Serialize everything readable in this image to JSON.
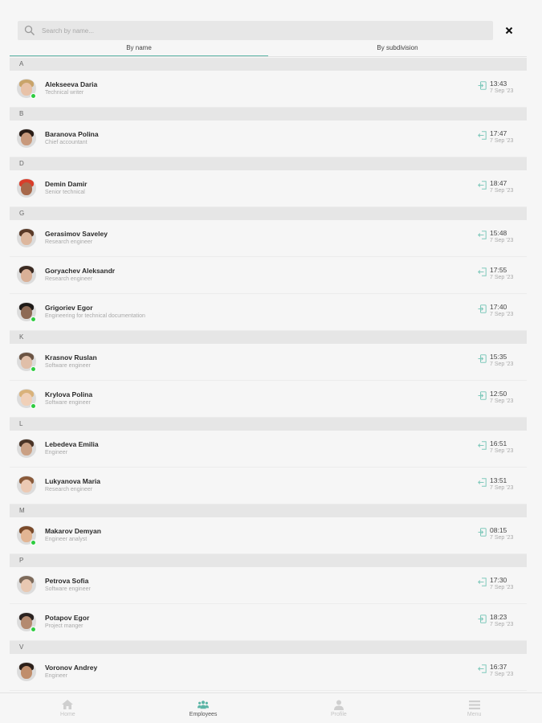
{
  "search": {
    "placeholder": "Search by name..."
  },
  "tabs": [
    {
      "label": "By name",
      "active": true
    },
    {
      "label": "By subdivision",
      "active": false
    }
  ],
  "sections": [
    {
      "letter": "A",
      "employees": [
        {
          "name": "Alekseeva Daria",
          "position": "Technical writer",
          "time": "13:43",
          "date": "7 Sep '23",
          "status": "in",
          "online": true,
          "skin": "#e8c2a8",
          "hair": "#c9a46a"
        }
      ]
    },
    {
      "letter": "B",
      "employees": [
        {
          "name": "Baranova Polina",
          "position": "Chief accountant",
          "time": "17:47",
          "date": "7 Sep '23",
          "status": "out",
          "online": false,
          "skin": "#c8997c",
          "hair": "#2a1d17"
        }
      ]
    },
    {
      "letter": "D",
      "employees": [
        {
          "name": "Demin Damir",
          "position": "Senior technical",
          "time": "18:47",
          "date": "7 Sep '23",
          "status": "out",
          "online": false,
          "skin": "#a7684a",
          "hair": "#d93d2a"
        }
      ]
    },
    {
      "letter": "G",
      "employees": [
        {
          "name": "Gerasimov Saveley",
          "position": "Research engineer",
          "time": "15:48",
          "date": "7 Sep '23",
          "status": "out",
          "online": false,
          "skin": "#ddb79e",
          "hair": "#5a3a28"
        },
        {
          "name": "Goryachev Aleksandr",
          "position": "Research engineer",
          "time": "17:55",
          "date": "7 Sep '23",
          "status": "out",
          "online": false,
          "skin": "#d9b097",
          "hair": "#3b2a22"
        },
        {
          "name": "Grigoriev Egor",
          "position": "Engineering for technical documentation",
          "time": "17:40",
          "date": "7 Sep '23",
          "status": "in",
          "online": true,
          "skin": "#8d6a55",
          "hair": "#1e1a18"
        }
      ]
    },
    {
      "letter": "K",
      "employees": [
        {
          "name": "Krasnov Ruslan",
          "position": "Software engineer",
          "time": "15:35",
          "date": "7 Sep '23",
          "status": "in",
          "online": true,
          "skin": "#e0bfa9",
          "hair": "#6b5444"
        },
        {
          "name": "Krylova Polina",
          "position": "Software engineer",
          "time": "12:50",
          "date": "7 Sep '23",
          "status": "in",
          "online": true,
          "skin": "#f0d0b8",
          "hair": "#d9b27a"
        }
      ]
    },
    {
      "letter": "L",
      "employees": [
        {
          "name": "Lebedeva Emilia",
          "position": "Engineer",
          "time": "16:51",
          "date": "7 Sep '23",
          "status": "out",
          "online": false,
          "skin": "#caa084",
          "hair": "#4a3426"
        },
        {
          "name": "Lukyanova Maria",
          "position": "Research engineer",
          "time": "13:51",
          "date": "7 Sep '23",
          "status": "out",
          "online": false,
          "skin": "#ecc9b3",
          "hair": "#8a5a3a"
        }
      ]
    },
    {
      "letter": "M",
      "employees": [
        {
          "name": "Makarov Demyan",
          "position": "Engineer analyst",
          "time": "08:15",
          "date": "7 Sep '23",
          "status": "in",
          "online": true,
          "skin": "#e2b593",
          "hair": "#7a4a2a"
        }
      ]
    },
    {
      "letter": "P",
      "employees": [
        {
          "name": "Petrova Sofia",
          "position": "Software engineer",
          "time": "17:30",
          "date": "7 Sep '23",
          "status": "out",
          "online": false,
          "skin": "#e8c8b2",
          "hair": "#7d6a5a"
        },
        {
          "name": "Potapov Egor",
          "position": "Project manger",
          "time": "18:23",
          "date": "7 Sep '23",
          "status": "in",
          "online": true,
          "skin": "#b48a70",
          "hair": "#2a2220"
        }
      ]
    },
    {
      "letter": "V",
      "employees": [
        {
          "name": "Voronov Andrey",
          "position": "Engineer",
          "time": "16:37",
          "date": "7 Sep '23",
          "status": "out",
          "online": false,
          "skin": "#c08e6c",
          "hair": "#2c201a"
        }
      ]
    }
  ],
  "bottom_nav": [
    {
      "label": "Home",
      "icon": "home-icon",
      "active": false
    },
    {
      "label": "Employees",
      "icon": "employees-icon",
      "active": true
    },
    {
      "label": "Profile",
      "icon": "profile-icon",
      "active": false
    },
    {
      "label": "Menu",
      "icon": "menu-icon",
      "active": false
    }
  ],
  "colors": {
    "accent": "#5bb5a6",
    "online": "#2ecc40",
    "section_bg": "#e6e6e6",
    "background": "#f6f6f6"
  }
}
